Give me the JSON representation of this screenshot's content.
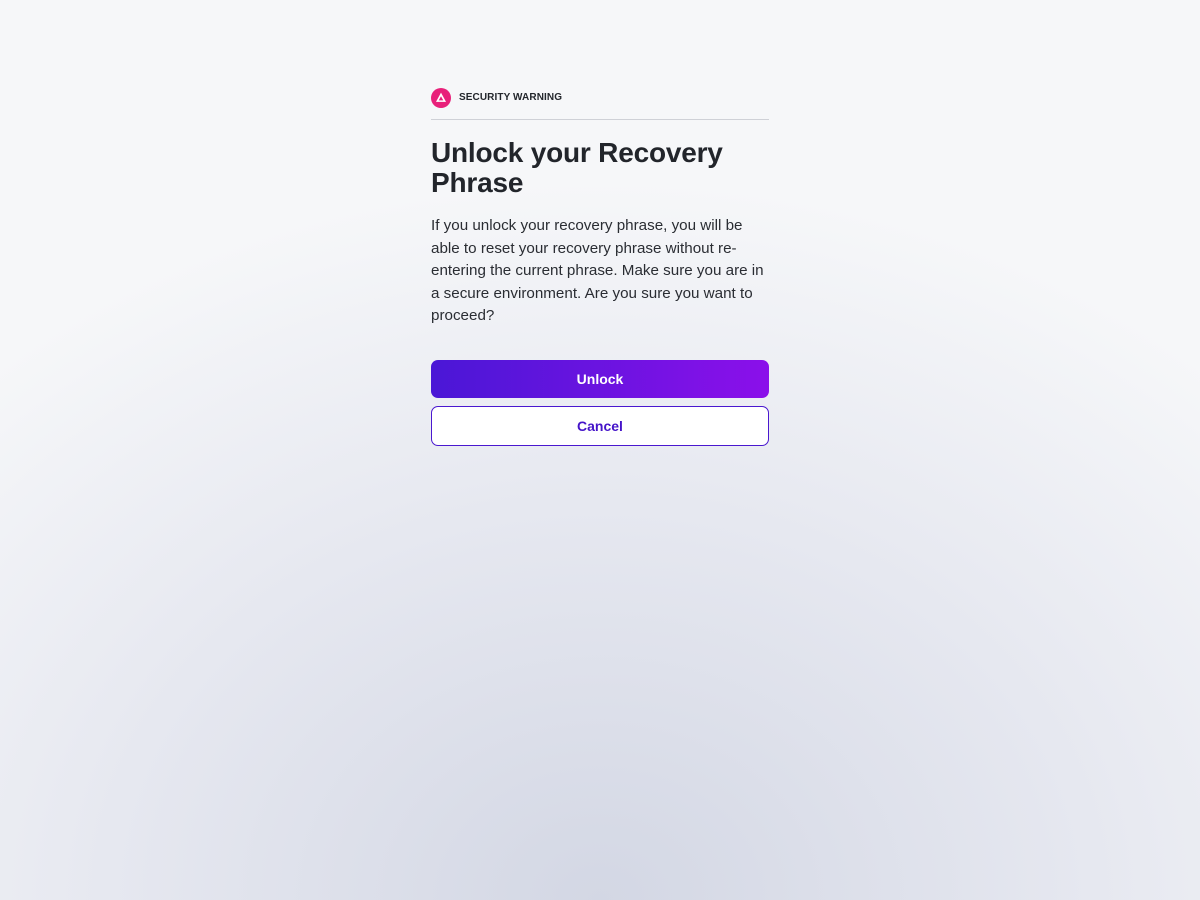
{
  "colors": {
    "warning_accent": "#e8207a",
    "primary_start": "#4a17d6",
    "primary_end": "#8b10ea",
    "outline": "#4a18cf"
  },
  "warning": {
    "icon": "warning-triangle-icon",
    "label": "SECURITY WARNING"
  },
  "dialog": {
    "title": "Unlock your Recovery Phrase",
    "body": "If you unlock your recovery phrase, you will be able to reset your recovery phrase without re-entering the current phrase. Make sure you are in a secure environment. Are you sure you want to proceed?"
  },
  "actions": {
    "unlock_label": "Unlock",
    "cancel_label": "Cancel"
  }
}
